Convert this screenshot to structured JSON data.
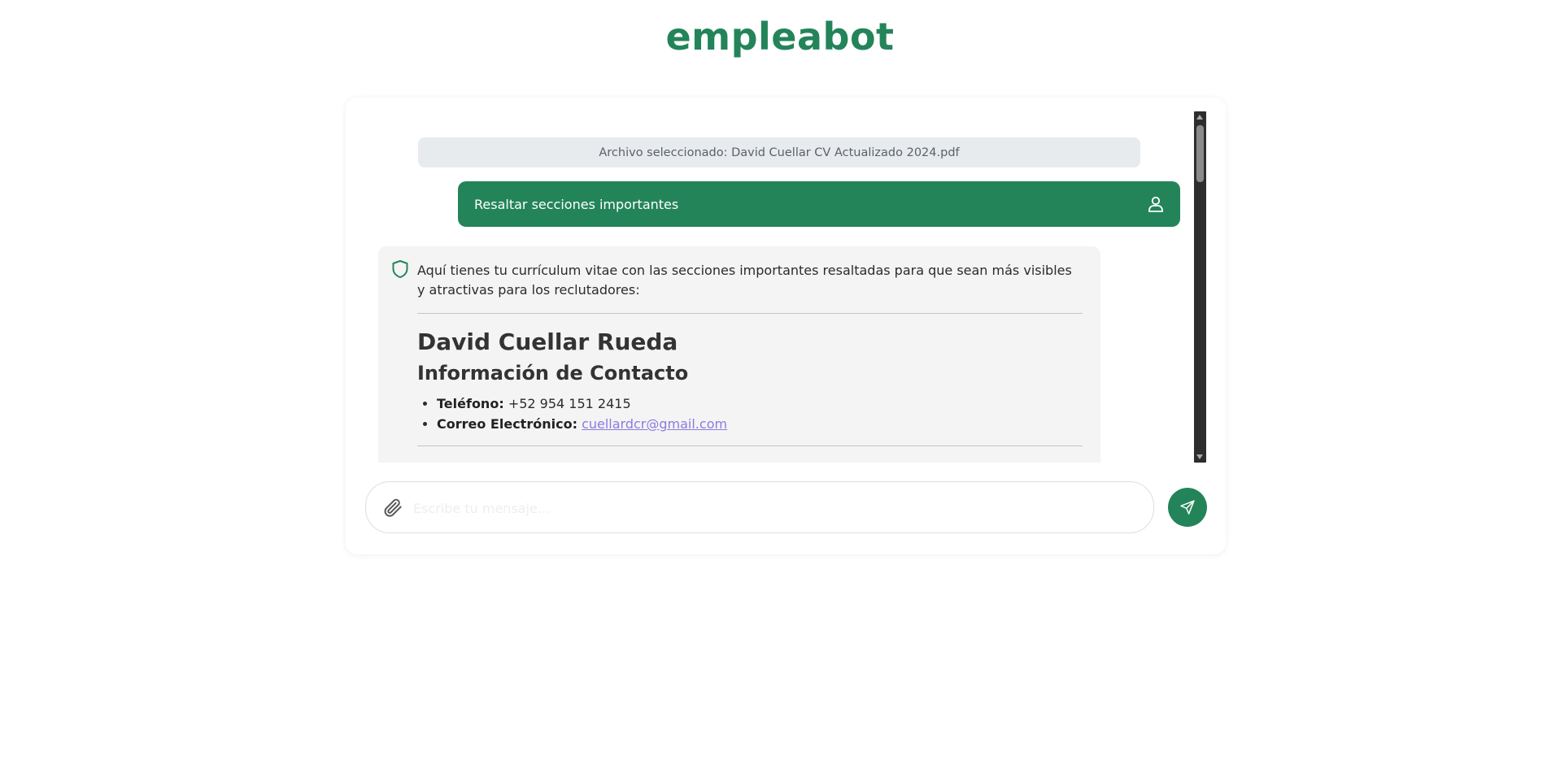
{
  "app": {
    "title": "empleabot",
    "accent_color": "#23845a"
  },
  "chat": {
    "file_notice": "Archivo seleccionado: David Cuellar CV Actualizado 2024.pdf",
    "user_message": {
      "text": "Resaltar secciones importantes",
      "icon": "user-icon"
    },
    "bot_message": {
      "icon": "shield-icon",
      "intro": "Aquí tienes tu currículum vitae con las secciones importantes resaltadas para que sean más visibles y atractivas para los reclutadores:",
      "cv_name": "David Cuellar Rueda",
      "section_title": "Información de Contacto",
      "contact": [
        {
          "label": "Teléfono:",
          "value": "+52 954 151 2415"
        },
        {
          "label": "Correo Electrónico:",
          "value": "cuellardcr@gmail.com"
        }
      ]
    }
  },
  "composer": {
    "placeholder": "Escribe tu mensaje...",
    "attach_icon": "paperclip-icon",
    "send_icon": "send-icon"
  }
}
